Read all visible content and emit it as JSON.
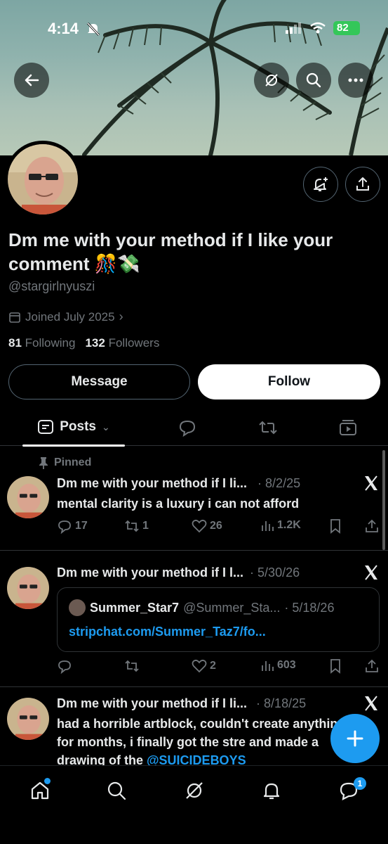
{
  "status_bar": {
    "time": "4:14",
    "battery": "82"
  },
  "profile": {
    "display_name": "Dm me with your method if I like your comment 🎊💸",
    "handle": "@stargirlnyuszi",
    "joined": "Joined July 2025",
    "following_count": "81",
    "following_label": "Following",
    "followers_count": "132",
    "followers_label": "Followers",
    "message_label": "Message",
    "follow_label": "Follow"
  },
  "tabs": {
    "active_label": "Posts"
  },
  "posts": [
    {
      "pinned_label": "Pinned",
      "author": "Dm me with your method if I li...",
      "date": "· 8/2/25",
      "text": "mental clarity is a luxury i can not afford",
      "replies": "17",
      "reposts": "1",
      "likes": "26",
      "views": "1.2K"
    },
    {
      "author": "Dm me with your method if I l...",
      "date": "· 5/30/26",
      "quote": {
        "name": "Summer_Star7",
        "handle": "@Summer_Sta...",
        "date": "· 5/18/26",
        "link": "stripchat.com/Summer_Taz7/fo..."
      },
      "likes": "2",
      "views": "603"
    },
    {
      "author": "Dm me with your method if I li...",
      "date": "· 8/18/25",
      "text_main": "had a horrible artblock, couldn't create anything for months, i finally got the stre and made a drawing of the ",
      "mention": "@SUICIDEBOYS"
    }
  ],
  "bottom_nav": {
    "messages_badge": "1"
  },
  "colors": {
    "accent": "#1d9bf0",
    "background": "#000000",
    "muted": "#71767b",
    "battery": "#34c759"
  },
  "icons": [
    "back-arrow-icon",
    "grok-icon",
    "search-icon",
    "more-icon",
    "notification-bell-plus-icon",
    "share-icon",
    "calendar-icon",
    "pin-icon",
    "x-logo-icon",
    "reply-icon",
    "repost-icon",
    "like-icon",
    "views-icon",
    "bookmark-icon",
    "plus-icon",
    "home-icon",
    "bell-icon",
    "messages-icon"
  ]
}
